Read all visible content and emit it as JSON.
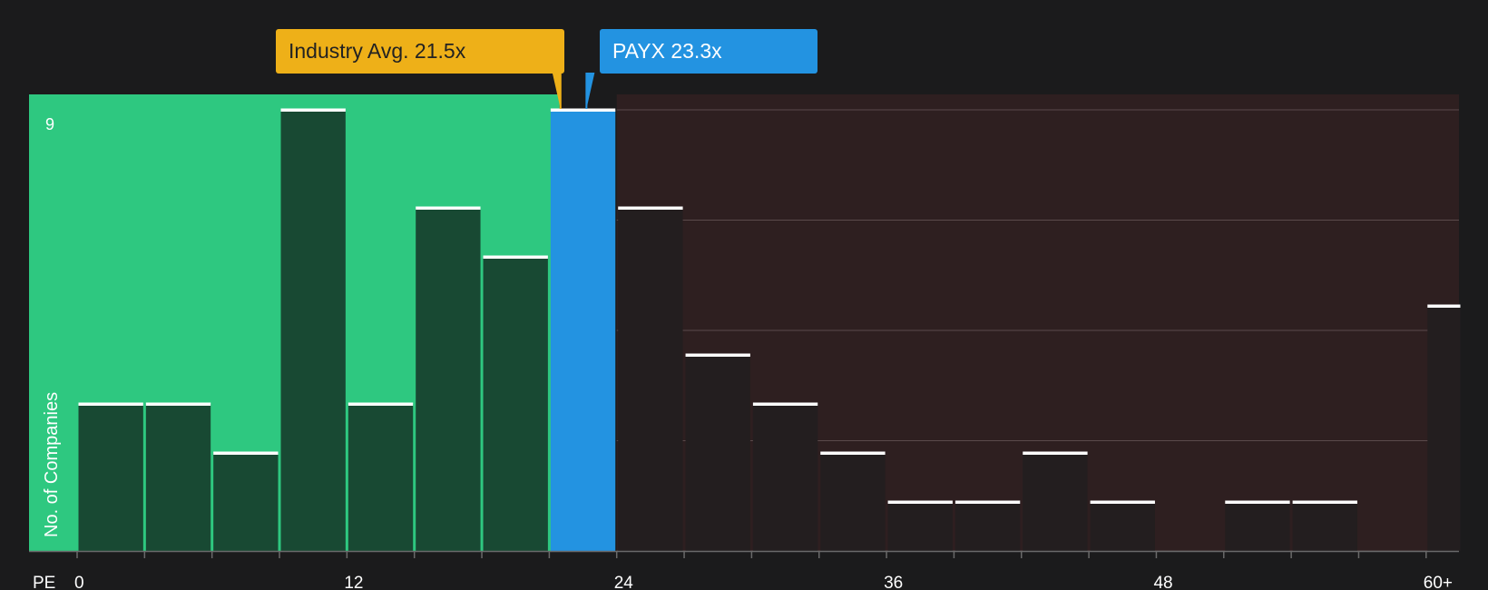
{
  "chart_data": {
    "type": "bar",
    "x_axis_title": "PE",
    "y_axis_title": "No. of Companies",
    "x_ticks": [
      "0",
      "12",
      "24",
      "36",
      "48",
      "60+"
    ],
    "y_max_label": "9",
    "ylim": [
      0,
      9
    ],
    "bin_width": 3,
    "bins": [
      {
        "start": 0,
        "value": 3
      },
      {
        "start": 3,
        "value": 3
      },
      {
        "start": 6,
        "value": 2
      },
      {
        "start": 9,
        "value": 9
      },
      {
        "start": 12,
        "value": 3
      },
      {
        "start": 15,
        "value": 7
      },
      {
        "start": 18,
        "value": 6
      },
      {
        "start": 21,
        "value": 9,
        "highlight": true
      },
      {
        "start": 24,
        "value": 7
      },
      {
        "start": 27,
        "value": 4
      },
      {
        "start": 30,
        "value": 3
      },
      {
        "start": 33,
        "value": 2
      },
      {
        "start": 36,
        "value": 1
      },
      {
        "start": 39,
        "value": 1
      },
      {
        "start": 42,
        "value": 2
      },
      {
        "start": 45,
        "value": 1
      },
      {
        "start": 48,
        "value": 0
      },
      {
        "start": 51,
        "value": 1
      },
      {
        "start": 54,
        "value": 1
      },
      {
        "start": 57,
        "value": 0
      },
      {
        "start": 60,
        "value": 5
      }
    ],
    "industry_avg": {
      "label": "Industry Avg. 21.5x",
      "value": 21.5
    },
    "company": {
      "label": "PAYX 23.3x",
      "value": 23.3
    },
    "colors": {
      "background": "#1b1b1c",
      "below_region": "#2ec880",
      "above_region": "#2e1f20",
      "highlight_bar": "#2393e1",
      "industry_callout": "#eeb018",
      "company_callout": "#2393e1",
      "bar_cap": "#ffffff"
    }
  }
}
